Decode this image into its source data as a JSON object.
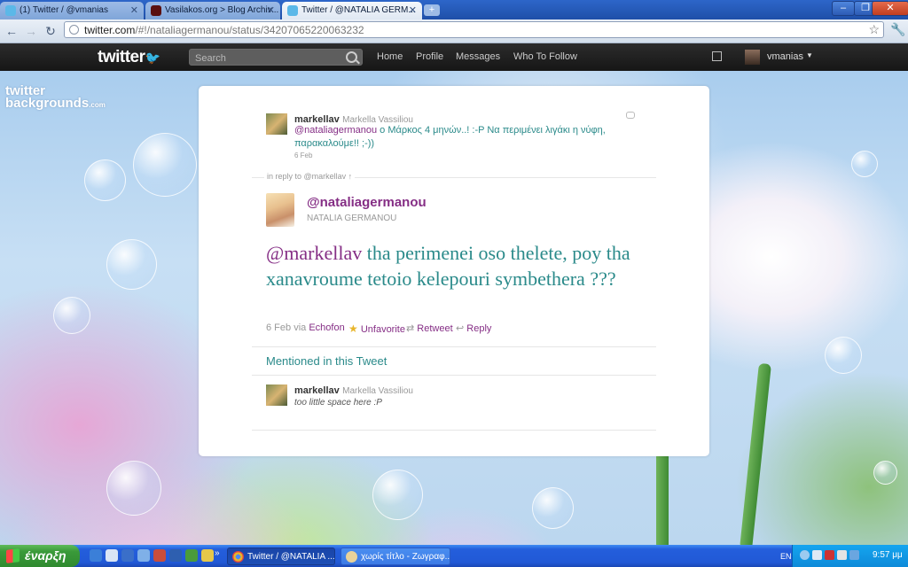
{
  "browser": {
    "tabs": [
      {
        "title": "(1) Twitter / @vmanias",
        "active": false
      },
      {
        "title": "Vasilakos.org > Blog Archiv...",
        "active": false
      },
      {
        "title": "Twitter / @NATALIA GERM...",
        "active": true
      }
    ],
    "url_domain": "twitter.com",
    "url_path": "/#!/nataliagermanou/status/34207065220063232"
  },
  "twitter_bar": {
    "logo": "twitter",
    "search_placeholder": "Search",
    "nav": [
      "Home",
      "Profile",
      "Messages",
      "Who To Follow"
    ],
    "username": "vmanias"
  },
  "watermark": {
    "line1": "twitter",
    "line2": "backgrounds",
    "suffix": ".com"
  },
  "parent_tweet": {
    "screen_name": "markellav",
    "full_name": "Markella Vassiliou",
    "mention": "@nataliagermanou",
    "text": " ο Μάρκος 4 μηνών..! :-P Να περιμένει λιγάκι η νύφη, παρακαλούμε!! ;-))",
    "date": "6 Feb"
  },
  "in_reply_to": "in reply to @markellav ↑",
  "main_tweet": {
    "screen_name": "@nataliagermanou",
    "full_name": "NATALIA GERMANOU",
    "mention": "@markellav",
    "text": " tha perimenei oso thelete, poy tha xanavroume tetoio kelepouri symbethera ???",
    "date": "6 Feb",
    "via": "via",
    "source": "Echofon",
    "actions": {
      "unfavorite": "Unfavorite",
      "retweet": "Retweet",
      "reply": "Reply"
    }
  },
  "mentioned": {
    "heading": "Mentioned in this Tweet",
    "screen_name": "markellav",
    "full_name": "Markella Vassiliou",
    "bio": "too little space here :P"
  },
  "taskbar": {
    "start": "έναρξη",
    "tasks": [
      {
        "title": "Twitter / @NATALIA ...",
        "active": true
      },
      {
        "title": "χωρίς τίτλο - Ζωγραφ...",
        "active": false
      }
    ],
    "lang": "EN",
    "clock": "9:57 μμ"
  },
  "colors": {
    "link_teal": "#2a8a8a",
    "link_purple": "#852e85",
    "twitter_bar": "#1e1e1e"
  }
}
